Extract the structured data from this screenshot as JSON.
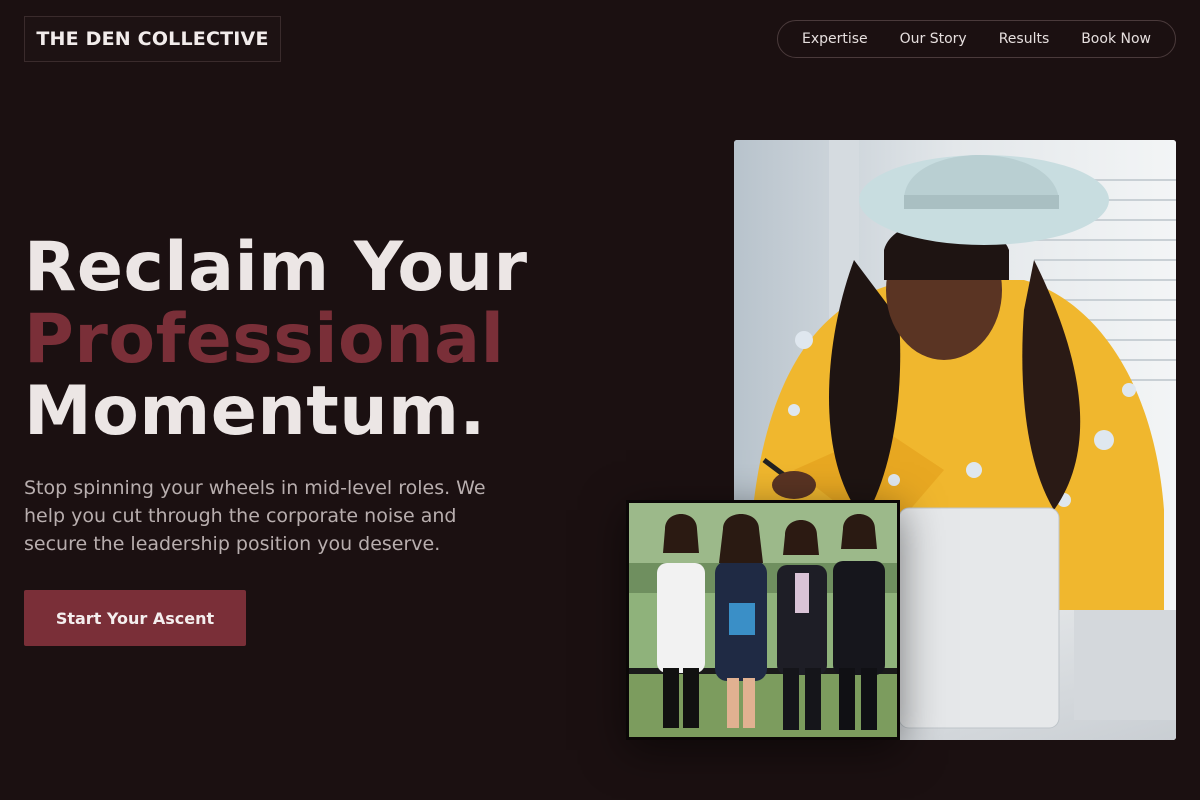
{
  "header": {
    "logo": "THE DEN COLLECTIVE",
    "nav": [
      "Expertise",
      "Our Story",
      "Results",
      "Book Now"
    ]
  },
  "hero": {
    "headline_line1": "Reclaim Your",
    "headline_accent": "Professional",
    "headline_line3": "Momentum.",
    "subtext": "Stop spinning your wheels in mid-level roles. We help you cut through the corporate noise and secure the leadership position you deserve.",
    "cta_label": "Start Your Ascent"
  },
  "images": {
    "main_alt": "Woman in a yellow floral blouse and light wide-brim hat writing at a desk",
    "group_alt": "Four professional women in business attire posing outdoors"
  },
  "colors": {
    "background": "#1b1011",
    "accent": "#7a2f38",
    "text": "#ece6e5",
    "muted_text": "#b8aeae"
  }
}
